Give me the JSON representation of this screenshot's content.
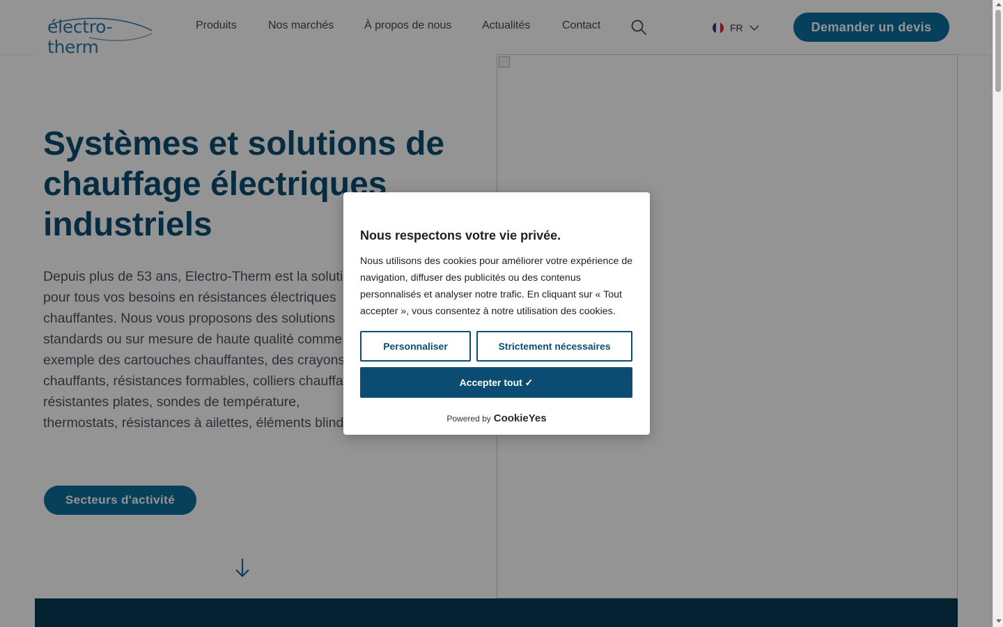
{
  "header": {
    "logo_text": "électro-therm",
    "nav": [
      {
        "label": "Produits"
      },
      {
        "label": "Nos marchés"
      },
      {
        "label": "À propos de nous"
      },
      {
        "label": "Actualités"
      },
      {
        "label": "Contact"
      }
    ],
    "search_icon": "search-icon",
    "language": {
      "code": "FR",
      "flag": [
        "#1f3e8c",
        "#ffffff",
        "#d8283a"
      ]
    },
    "cta_label": "Demander un devis"
  },
  "hero": {
    "title": "Systèmes et solutions de chauffage électriques industriels",
    "description": "Depuis plus de 53 ans, Electro-Therm est la solution pour tous vos besoins en résistances électriques chauffantes. Nous vous proposons des solutions standards ou sur mesure de haute qualité comme par exemple des cartouches chauffantes, des crayons chauffants, résistances formables, colliers chauffants, résistantes plates, sondes de température, thermostats, résistances à ailettes, éléments blindés, infrarouges céramiques, connectique...",
    "sector_button": "Secteurs d'activité",
    "scroll_icon": "arrow-down-icon"
  },
  "cookie_banner": {
    "title": "Nous respectons votre vie privée.",
    "text": "Nous utilisons des cookies pour améliorer votre expérience de navigation, diffuser des publicités ou des contenus personnalisés et analyser notre trafic. En cliquant sur « Tout accepter », vous consentez à notre utilisation des cookies.",
    "customize_label": "Personnaliser",
    "necessary_label": "Strictement nécessaires",
    "accept_label": "Accepter tout ✓",
    "powered_by": "Powered by",
    "brand": "CookieYes"
  },
  "colors": {
    "brand_dark": "#0b4d72",
    "brand_button": "#0b6f9c",
    "band": "#063a55"
  }
}
